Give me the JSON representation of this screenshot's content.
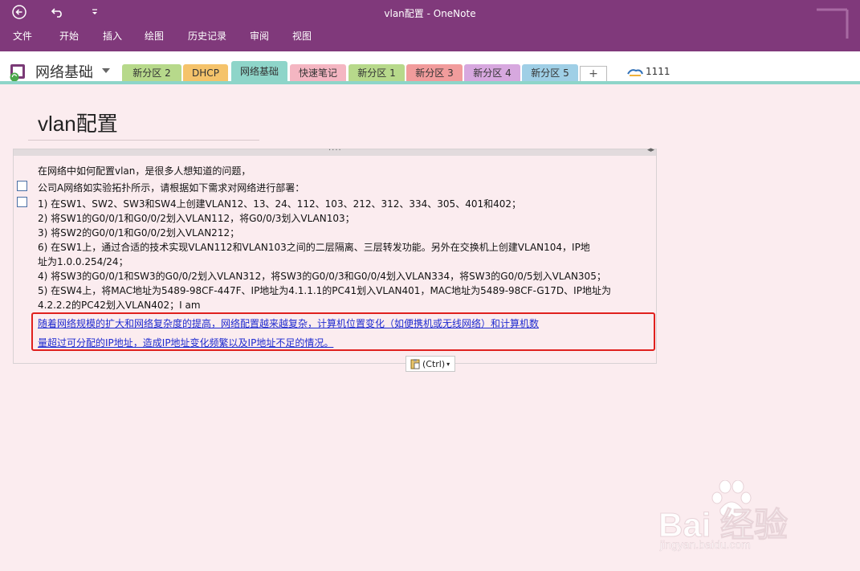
{
  "window": {
    "title": "vlan配置 - OneNote"
  },
  "menu": {
    "items": [
      "文件",
      "开始",
      "插入",
      "绘图",
      "历史记录",
      "审阅",
      "视图"
    ]
  },
  "notebook": {
    "name": "网络基础",
    "sections": [
      {
        "label": "新分区 2",
        "color": "#b7d98b"
      },
      {
        "label": "DHCP",
        "color": "#f5c36b"
      },
      {
        "label": "网络基础",
        "color": "#8ed5c9",
        "active": true
      },
      {
        "label": "快速笔记",
        "color": "#f4b6c2"
      },
      {
        "label": "新分区 1",
        "color": "#b7d98b"
      },
      {
        "label": "新分区 3",
        "color": "#f19c9c"
      },
      {
        "label": "新分区 4",
        "color": "#d7a8df"
      },
      {
        "label": "新分区 5",
        "color": "#9fcfe6"
      }
    ],
    "add_tab_label": "+",
    "user": "1111"
  },
  "page": {
    "title": "vlan配置",
    "lines": [
      "在网络中如何配置vlan，是很多人想知道的问题，",
      "公司A网络如实验拓扑所示，请根据如下需求对网络进行部署：",
      "1) 在SW1、SW2、SW3和SW4上创建VLAN12、13、24、112、103、212、312、334、305、401和402；",
      "2) 将SW1的G0/0/1和G0/0/2划入VLAN112，将G0/0/3划入VLAN103；",
      "3) 将SW2的G0/0/1和G0/0/2划入VLAN212；",
      "6) 在SW1上，通过合适的技术实现VLAN112和VLAN103之间的二层隔离、三层转发功能。另外在交换机上创建VLAN104，IP地",
      "址为1.0.0.254/24；",
      "4) 将SW3的G0/0/1和SW3的G0/0/2划入VLAN312，将SW3的G0/0/3和G0/0/4划入VLAN334，将SW3的G0/0/5划入VLAN305；",
      "5) 在SW4上，将MAC地址为5489-98CF-447F、IP地址为4.1.1.1的PC41划入VLAN401，MAC地址为5489-98CF-G17D、IP地址为",
      "4.2.2.2的PC42划入VLAN402；I am"
    ],
    "highlighted_lines": [
      "随着网络规模的扩大和网络复杂度的提高，网络配置越来越复杂，计算机位置变化（如便携机或无线网络）和计算机数",
      "量超过可分配的IP地址，造成IP地址变化频繁以及IP地址不足的情况。"
    ],
    "paste_options_label": "(Ctrl)"
  },
  "watermark": {
    "brand": "Bai 经验",
    "url": "jingyan.baidu.com"
  },
  "colors": {
    "ribbon": "#80397b",
    "page_bg": "#fbecef",
    "highlight_border": "#e0201e",
    "link": "#1f2bd0"
  }
}
